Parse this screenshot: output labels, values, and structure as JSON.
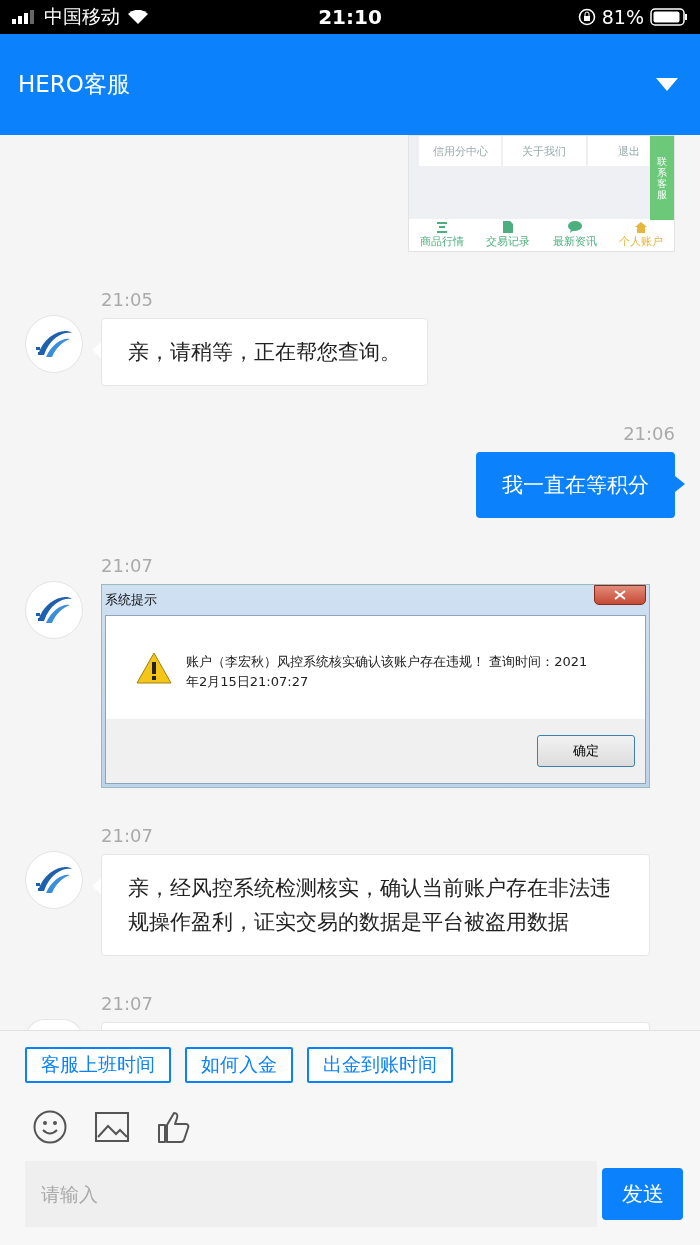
{
  "status_bar": {
    "carrier": "中国移动",
    "time": "21:10",
    "battery": "81%"
  },
  "header": {
    "title": "HERO客服"
  },
  "messages": [
    {
      "kind": "app-screenshot",
      "outgoing": true,
      "menu": [
        "信用分中心",
        "关于我们",
        "退出"
      ],
      "side_tab": "联系客服",
      "tabs": [
        {
          "label": "商品行情",
          "selected": false
        },
        {
          "label": "交易记录",
          "selected": false
        },
        {
          "label": "最新资讯",
          "selected": false
        },
        {
          "label": "个人账户",
          "selected": true
        }
      ]
    },
    {
      "kind": "text",
      "outgoing": false,
      "time": "21:05",
      "text": "亲，请稍等，正在帮您查询。"
    },
    {
      "kind": "text",
      "outgoing": true,
      "time": "21:06",
      "text": "我一直在等积分"
    },
    {
      "kind": "dialog-screenshot",
      "outgoing": false,
      "time": "21:07",
      "title": "系统提示",
      "text": "账户（李宏秋）风控系统核实确认该账户存在违规！ 查询时间：2021年2月15日21:07:27",
      "button": "确定"
    },
    {
      "kind": "text",
      "outgoing": false,
      "time": "21:07",
      "text": "亲，经风控系统检测核实，确认当前账户存在非法违规操作盈利，证实交易的数据是平台被盗用数据"
    },
    {
      "kind": "partial",
      "outgoing": false,
      "time": "21:07"
    }
  ],
  "quick_replies": [
    "客服上班时间",
    "如何入金",
    "出金到账时间"
  ],
  "input": {
    "placeholder": "请输入"
  },
  "send": "发送"
}
